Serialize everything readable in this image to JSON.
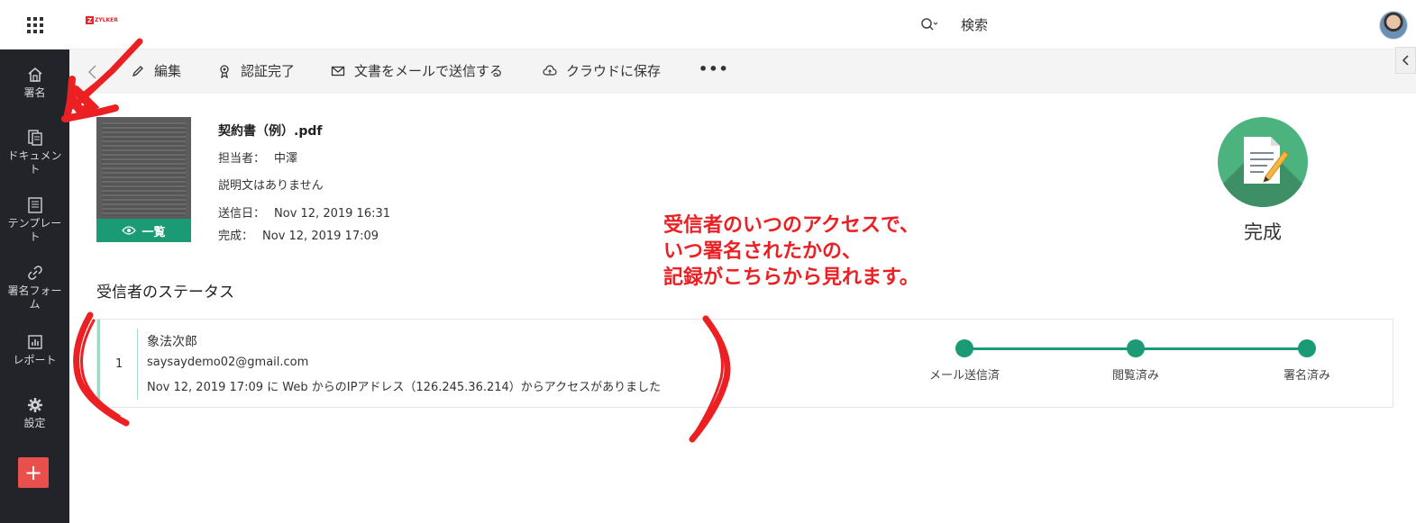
{
  "header": {
    "logo_text": "ZYLKER",
    "search_label": "検索"
  },
  "sidebar": {
    "items": [
      {
        "label": "署名",
        "icon": "home-icon"
      },
      {
        "label": "ドキュメント",
        "icon": "documents-icon"
      },
      {
        "label": "テンプレート",
        "icon": "template-icon"
      },
      {
        "label": "署名フォーム",
        "icon": "link-icon"
      },
      {
        "label": "レポート",
        "icon": "report-icon"
      },
      {
        "label": "設定",
        "icon": "gear-icon"
      }
    ],
    "add_label": "+"
  },
  "toolbar": {
    "edit": "編集",
    "certify": "認証完了",
    "email": "文書をメールで送信する",
    "cloud": "クラウドに保存",
    "more": "•••"
  },
  "document": {
    "title": "契約書（例）.pdf",
    "owner_label": "担当者：",
    "owner": "中澤",
    "description": "説明文はありません",
    "sent_label": "送信日：",
    "sent": "Nov 12, 2019 16:31",
    "completed_label": "完成：",
    "completed": "Nov 12, 2019 17:09",
    "view_label": "一覧",
    "status": "完成"
  },
  "recipients": {
    "section_title": "受信者のステータス",
    "items": [
      {
        "number": "1",
        "name": "象法次郎",
        "email": "saysaydemo02@gmail.com",
        "access": "Nov 12, 2019 17:09 に Web からのIPアドレス（126.245.36.214）からアクセスがありました",
        "steps": [
          "メール送信済",
          "閲覧済み",
          "署名済み"
        ]
      }
    ]
  },
  "annotation": {
    "line1": "受信者のいつのアクセスで、",
    "line2": "いつ署名されたかの、",
    "line3": "記録がこちらから見れます。",
    "color": "#ec1f23"
  },
  "colors": {
    "accent": "#1a9b76",
    "sidebar": "#222429",
    "add_button": "#e9504d",
    "status_circle": "#4cb37f"
  }
}
